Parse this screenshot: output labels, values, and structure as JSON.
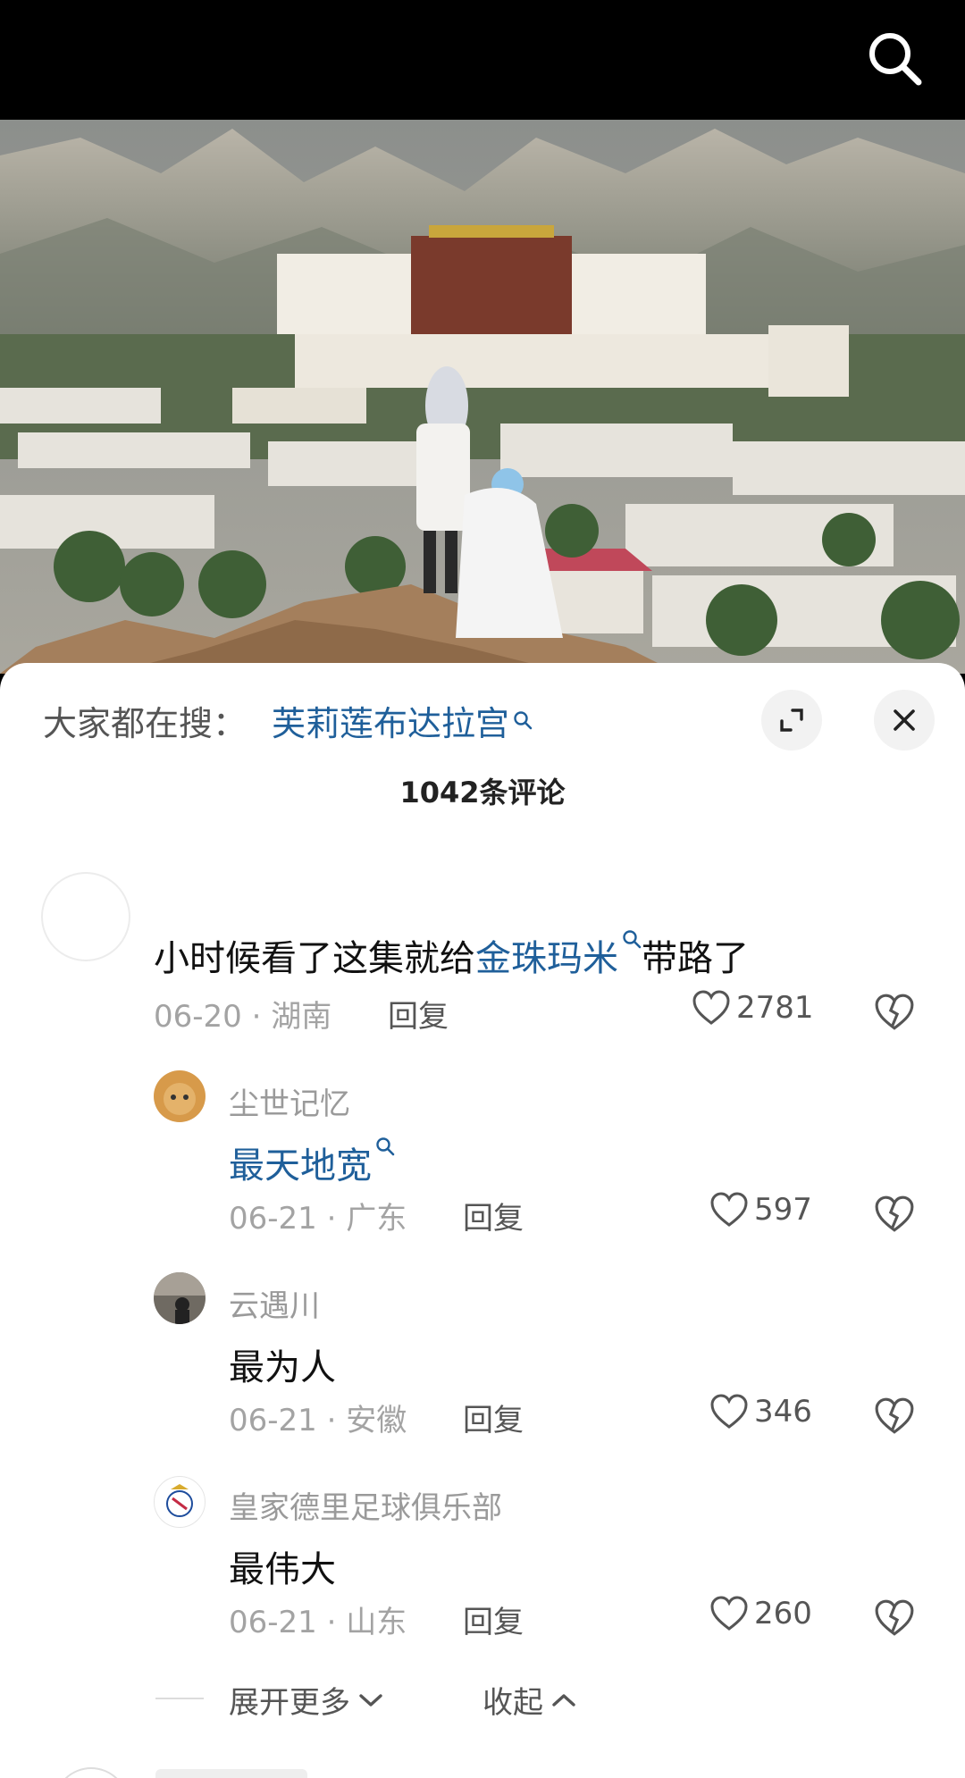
{
  "header": {
    "search_icon": "search-icon"
  },
  "video": {
    "description": ""
  },
  "sheet": {
    "everyone_search_label": "大家都在搜：",
    "everyone_search_term": "芙莉莲布达拉宫",
    "expand_icon": "expand-icon",
    "close_icon": "close-icon",
    "comment_count": "1042条评论"
  },
  "comment": {
    "text_before": "小时候看了这集就给",
    "text_link": "金珠玛米",
    "text_after": "带路了",
    "date": "06-20",
    "location": "湖南",
    "reply": "回复",
    "likes": "2781"
  },
  "replies": [
    {
      "username": "尘世记忆",
      "text": "最天地宽",
      "text_is_link": true,
      "date": "06-21",
      "location": "广东",
      "reply": "回复",
      "likes": "597"
    },
    {
      "username": "云遇川",
      "text": "最为人",
      "text_is_link": false,
      "date": "06-21",
      "location": "安徽",
      "reply": "回复",
      "likes": "346"
    },
    {
      "username": "皇家德里足球俱乐部",
      "text": "最伟大",
      "text_is_link": false,
      "date": "06-21",
      "location": "山东",
      "reply": "回复",
      "likes": "260"
    }
  ],
  "footer": {
    "expand_more": "展开更多",
    "collapse": "收起"
  },
  "colors": {
    "link": "#1f5f9a",
    "meta": "#a3a3a3",
    "background": "#ffffff"
  }
}
